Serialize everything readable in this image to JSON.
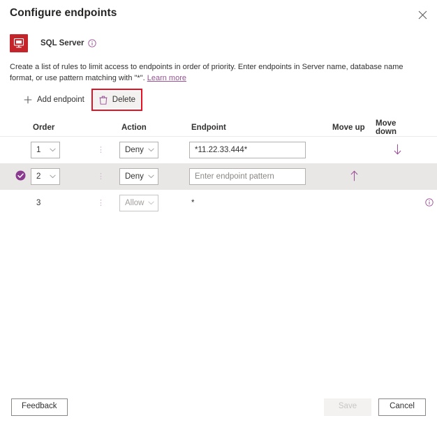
{
  "header": {
    "title": "Configure endpoints",
    "close_icon": "close-icon",
    "close_label": "Close"
  },
  "resource": {
    "icon_name": "sql-server-icon",
    "icon_text": "SQL",
    "name": "SQL Server",
    "info_icon": "info-icon"
  },
  "description": {
    "text_before_link": "Create a list of rules to limit access to endpoints in order of priority. Enter endpoints in Server name, database name format, or use pattern matching with \"*\". ",
    "link_label": "Learn more"
  },
  "commandbar": {
    "add_icon": "plus-icon",
    "add_label": "Add endpoint",
    "delete_icon": "trash-icon",
    "delete_label": "Delete",
    "annotation_color": "#e81123"
  },
  "table": {
    "columns": [
      {
        "key": "order",
        "label": "Order"
      },
      {
        "key": "action",
        "label": "Action"
      },
      {
        "key": "endpoint",
        "label": "Endpoint"
      },
      {
        "key": "move_up",
        "label": "Move up"
      },
      {
        "key": "move_down",
        "label": "Move down"
      }
    ],
    "rows": [
      {
        "selected": false,
        "order": "1",
        "order_editable": true,
        "action": "Deny",
        "action_editable": true,
        "endpoint_value": "*11.22.33.444*",
        "endpoint_placeholder": "Enter endpoint pattern",
        "endpoint_editable": true,
        "move_up": "",
        "move_down": "↓",
        "info": ""
      },
      {
        "selected": true,
        "order": "2",
        "order_editable": true,
        "action": "Deny",
        "action_editable": true,
        "endpoint_value": "",
        "endpoint_placeholder": "Enter endpoint pattern",
        "endpoint_editable": true,
        "move_up": "↑",
        "move_down": "",
        "info": ""
      },
      {
        "selected": false,
        "order": "3",
        "order_editable": false,
        "action": "Allow",
        "action_editable": false,
        "endpoint_value": "*",
        "endpoint_placeholder": "",
        "endpoint_editable": false,
        "move_up": "",
        "move_down": "",
        "info": "info-icon"
      }
    ]
  },
  "footer": {
    "feedback_label": "Feedback",
    "save_label": "Save",
    "save_disabled": true,
    "cancel_label": "Cancel"
  },
  "colors": {
    "accent_purple": "#9b4f96",
    "sql_red": "#c4252a",
    "annotation_red": "#e81123",
    "selected_row": "#e9e7e6"
  }
}
